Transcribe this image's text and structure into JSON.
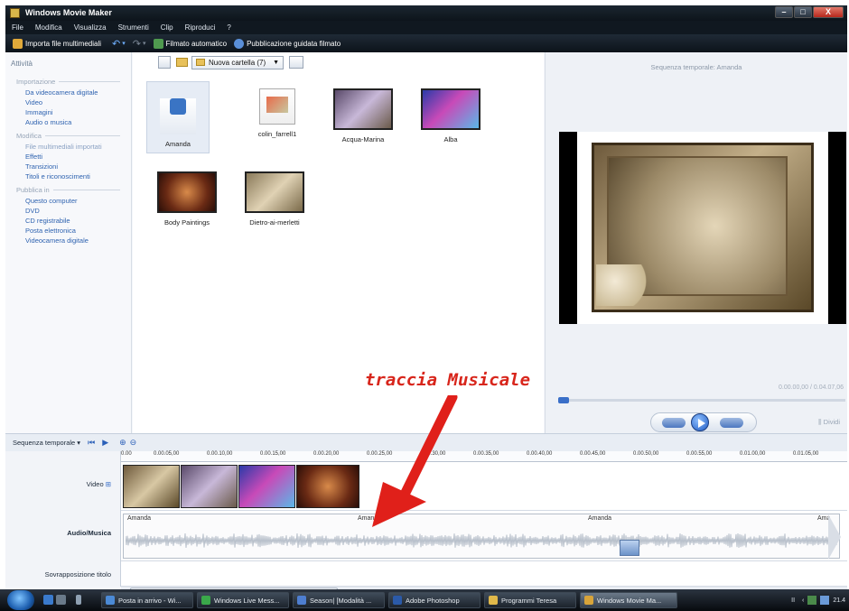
{
  "window": {
    "title": "Windows Movie Maker",
    "buttons": [
      "–",
      "□",
      "X"
    ]
  },
  "menu": [
    "File",
    "Modifica",
    "Visualizza",
    "Strumenti",
    "Clip",
    "Riproduci",
    "?"
  ],
  "toolbar": {
    "import": "Importa file multimediali",
    "undo": "↶",
    "redo": "↷",
    "automovie": "Filmato automatico",
    "publish": "Pubblicazione guidata filmato"
  },
  "tasks": {
    "header": "Attività",
    "sections": [
      {
        "title": "Importazione",
        "items": [
          "Da videocamera digitale",
          "Video",
          "Immagini",
          "Audio o musica"
        ]
      },
      {
        "title": "Modifica",
        "items": [
          "File multimediali importati",
          "Effetti",
          "Transizioni",
          "Titoli e riconoscimenti"
        ]
      },
      {
        "title": "Pubblica in",
        "items": [
          "Questo computer",
          "DVD",
          "CD registrabile",
          "Posta elettronica",
          "Videocamera digitale"
        ]
      }
    ]
  },
  "collections": {
    "folder": "Nuova cartella (7)",
    "items": [
      "Amanda",
      "colin_farrell1",
      "Acqua-Marina",
      "Alba",
      "Body Paintings",
      "Dietro-ai-merletti"
    ]
  },
  "preview": {
    "title": "Sequenza temporale: Amanda",
    "time": "0.00.00,00 / 0.04.07,06",
    "split": "Dividi"
  },
  "annotation": "traccia Musicale",
  "timeline": {
    "mode": "Sequenza temporale",
    "ruler": [
      "0.00",
      "0.00.05,00",
      "0.00.10,00",
      "0.00.15,00",
      "0.00.20,00",
      "0.00.25,00",
      "0.00.30,00",
      "0.00.35,00",
      "0.00.40,00",
      "0.00.45,00",
      "0.00.50,00",
      "0.00.55,00",
      "0.01.00,00",
      "0.01.05,00"
    ],
    "tracks": {
      "video": "Video",
      "audio": "Audio/Musica",
      "title": "Sovrapposizione titolo"
    },
    "audio_labels": [
      "Amanda",
      "Amanda",
      "Amanda",
      "Ama"
    ]
  },
  "taskbar": {
    "items": [
      "Posta in arrivo - Wi...",
      "Windows Live Mess...",
      "Season| [Modalità ...",
      "Adobe Photoshop",
      "Programmi Teresa",
      "Windows Movie Ma..."
    ],
    "clock": "21.4"
  }
}
